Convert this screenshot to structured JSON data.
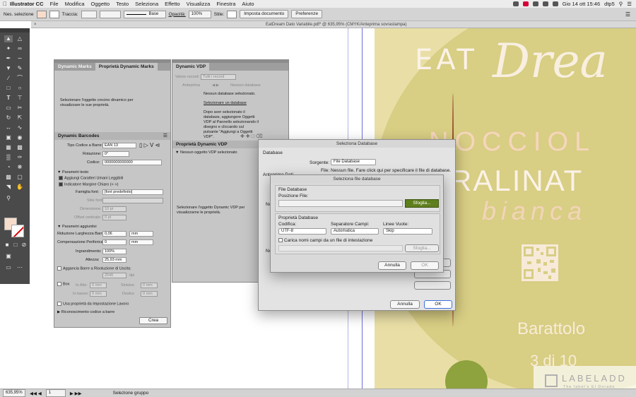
{
  "menubar": {
    "app_name": "Illustrator CC",
    "items": [
      "File",
      "Modifica",
      "Oggetto",
      "Testo",
      "Seleziona",
      "Effetto",
      "Visualizza",
      "Finestra",
      "Aiuto"
    ],
    "clock": "Gio 14 ott 15:46",
    "user": "dtp5"
  },
  "control_bar": {
    "selection": "Nes. selezione",
    "stroke_label": "Traccia:",
    "brush": "Base",
    "opacity_label": "Opacità:",
    "opacity_value": "100%",
    "style_label": "Stile:",
    "doc_setup": "Imposta documento",
    "preferences": "Preferenze"
  },
  "tab": {
    "title": "EatDream Dato Variabile.pdf* @ 635,95% (CMYK/Anteprima sovrastampa)"
  },
  "dynamic_marks_panel": {
    "tab1": "Dynamic Marks",
    "tab2": "Proprietà Dynamic Marks",
    "message": "Selezionare l'oggetto crocino dinamico per visualizzare le sue proprietà."
  },
  "dynamic_barcodes": {
    "title": "Dynamic Barcodes",
    "type_label": "Tipo Codice a Barre:",
    "type_value": "EAN 13",
    "rotation_label": "Rotazione:",
    "rotation_value": "0°",
    "code_label": "Codice:",
    "code_value": "0000000000000",
    "text_params": "Parametri testo",
    "add_human": "Aggiungi Caratteri Umani Leggibili",
    "margin_indicator": "Indicatore Margine Chiaro (< >)",
    "font_family_label": "Famiglia font:",
    "font_family_value": "[font predefinito]",
    "font_style_label": "Stile font:",
    "size_label": "Dimensione:",
    "size_value": "10 pt",
    "offset_label": "Offset verticale:",
    "offset_value": "0 pt",
    "extra_params": "Parametri aggiuntivi",
    "bar_reduction_label": "Riduzione Larghezza Barre:",
    "bar_reduction_value": "0,06",
    "unit_mm": "mm",
    "peripheral_label": "Compensazione Periferica:",
    "peripheral_value": "0",
    "magnification_label": "Ingrandimento:",
    "magnification_value": "100%",
    "height_label": "Altezza:",
    "height_value": "25,93 mm",
    "hook_label": "Aggancia Barre a Risoluzione di Uscita:",
    "dpi_value": "2540",
    "dpi_unit": "dpi",
    "box_label": "Box",
    "top_label": "In Alto:",
    "right_label": "Sinistra:",
    "bottom_label": "In basso:",
    "left_label": "Destra:",
    "zero_mm": "0 mm",
    "workspace_label": "Usa proprietà da Impostazione Lavoro",
    "recognition_label": "Riconoscimento codice a barre",
    "create_btn": "Crea"
  },
  "dynamic_vdp": {
    "title": "Dynamic VDP",
    "records_label": "Valore record:",
    "records_value": "Tutti i record",
    "preview_label": "Anteprima",
    "no_db_short": "Nessun database",
    "no_db": "Nessun database selezionato.",
    "select_db": "Selezionare un database",
    "instructions": "Dopo aver selezionato il database, aggiungere Oggetti VDP al Pannello selezionando il disegno e cliccando sul pulsante \"Aggiungi a Oggetti VDP\".",
    "props_title": "Proprietà Dynamic VDP",
    "no_obj": "Nessun oggetto VDP selezionato",
    "props_msg": "Selezionare l'oggetto Dynamic VDP per visualizzarne le proprietà."
  },
  "db_dialog": {
    "title": "Seleziona Database",
    "section": "Database",
    "source_label": "Sorgente:",
    "source_value": "File Database",
    "file_label": "File:",
    "file_value": "Nessun file. Fare click qui per specificare il file di database.",
    "preview_label": "Anteprima Dati",
    "no_label": "No",
    "cancel": "Annulla",
    "ok": "OK"
  },
  "file_dialog": {
    "title": "Seleziona file database",
    "section1": "File Database",
    "position_label": "Posizione File:",
    "browse": "Sfoglia...",
    "section2": "Proprietà Database",
    "encoding_label": "Codifica:",
    "encoding_value": "UTF-8",
    "separator_label": "Separatore Campi:",
    "separator_value": "Automatica",
    "empty_lines_label": "Linee Vuote:",
    "empty_lines_value": "Skip",
    "header_checkbox": "Carica nomi campi da un file di intestazione",
    "browse2": "Sfoglia...",
    "cancel": "Annulla",
    "ok": "OK"
  },
  "artwork": {
    "eat": "EAT",
    "dream": "Drea",
    "nocciola": "NOCCIOL",
    "pralinata": "PRALINAT",
    "bianca": "bianca",
    "barattolo": "Barattolo",
    "count": "3 di 10"
  },
  "logo": {
    "name": "LABELADD",
    "tagline": "The label's El Dorado"
  },
  "statusbar": {
    "zoom": "635,95%",
    "page": "1",
    "status": "Selezione gruppo"
  },
  "colors": {
    "accent_green": "#5e7f1b",
    "panel_bg": "#c6c6c6",
    "art_yellow": "#e9dfa6"
  }
}
